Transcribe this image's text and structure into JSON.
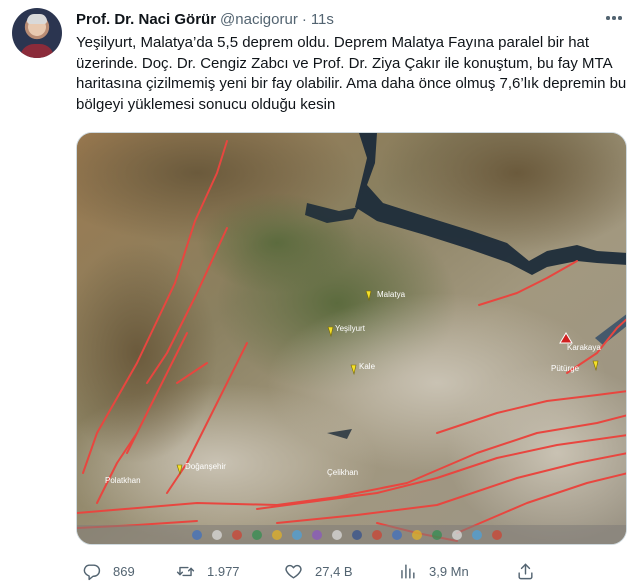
{
  "author": {
    "name": "Prof. Dr. Naci Görür",
    "handle": "@nacigorur",
    "separator": "·",
    "time": "11s"
  },
  "tweet_text": "Yeşilyurt, Malatya’da 5,5 deprem oldu. Deprem Malatya Fayına paralel bir hat üzerinde. Doç. Dr. Cengiz Zabcı ve Prof. Dr. Ziya Çakır ile konuştum, bu fay MTA haritasına çizilmemiş yeni bir fay olabilir. Ama daha önce olmuş 7,6’lık depremin bu bölgeyi yüklemesi sonucu olduğu kesin",
  "map": {
    "labels": {
      "malatya": "Malatya",
      "yesilyurt": "Yeşilyurt",
      "kale": "Kale",
      "karakaya": "Karakaya",
      "pulumur": "Pütürge",
      "dogansehir": "Doğanşehir",
      "polatkhan": "Polatkhan",
      "celikhan": "Çelikhan"
    },
    "colors": {
      "fault": "#e8463f",
      "pin": "#f5e12a",
      "water": "#1d2c3a"
    }
  },
  "actions": {
    "replies": "869",
    "retweets": "1.977",
    "likes": "27,4 B",
    "views": "3,9 Mn"
  }
}
